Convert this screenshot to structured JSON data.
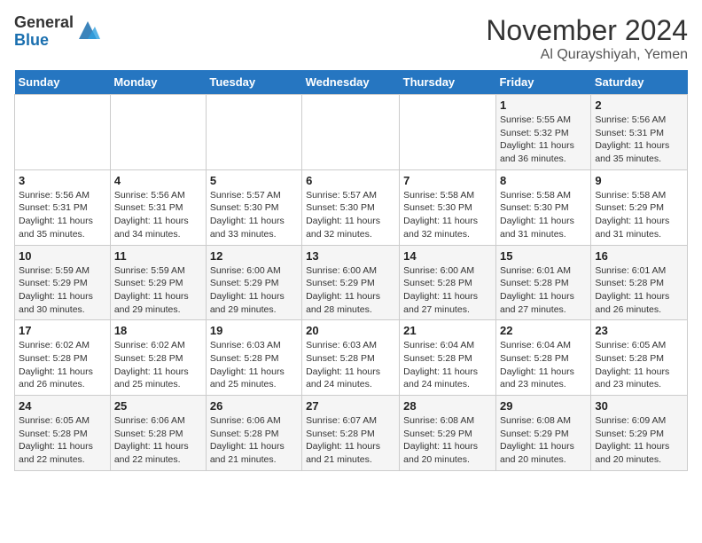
{
  "header": {
    "logo_general": "General",
    "logo_blue": "Blue",
    "month": "November 2024",
    "location": "Al Qurayshiyah, Yemen"
  },
  "weekdays": [
    "Sunday",
    "Monday",
    "Tuesday",
    "Wednesday",
    "Thursday",
    "Friday",
    "Saturday"
  ],
  "weeks": [
    [
      {
        "day": "",
        "info": ""
      },
      {
        "day": "",
        "info": ""
      },
      {
        "day": "",
        "info": ""
      },
      {
        "day": "",
        "info": ""
      },
      {
        "day": "",
        "info": ""
      },
      {
        "day": "1",
        "info": "Sunrise: 5:55 AM\nSunset: 5:32 PM\nDaylight: 11 hours and 36 minutes."
      },
      {
        "day": "2",
        "info": "Sunrise: 5:56 AM\nSunset: 5:31 PM\nDaylight: 11 hours and 35 minutes."
      }
    ],
    [
      {
        "day": "3",
        "info": "Sunrise: 5:56 AM\nSunset: 5:31 PM\nDaylight: 11 hours and 35 minutes."
      },
      {
        "day": "4",
        "info": "Sunrise: 5:56 AM\nSunset: 5:31 PM\nDaylight: 11 hours and 34 minutes."
      },
      {
        "day": "5",
        "info": "Sunrise: 5:57 AM\nSunset: 5:30 PM\nDaylight: 11 hours and 33 minutes."
      },
      {
        "day": "6",
        "info": "Sunrise: 5:57 AM\nSunset: 5:30 PM\nDaylight: 11 hours and 32 minutes."
      },
      {
        "day": "7",
        "info": "Sunrise: 5:58 AM\nSunset: 5:30 PM\nDaylight: 11 hours and 32 minutes."
      },
      {
        "day": "8",
        "info": "Sunrise: 5:58 AM\nSunset: 5:30 PM\nDaylight: 11 hours and 31 minutes."
      },
      {
        "day": "9",
        "info": "Sunrise: 5:58 AM\nSunset: 5:29 PM\nDaylight: 11 hours and 31 minutes."
      }
    ],
    [
      {
        "day": "10",
        "info": "Sunrise: 5:59 AM\nSunset: 5:29 PM\nDaylight: 11 hours and 30 minutes."
      },
      {
        "day": "11",
        "info": "Sunrise: 5:59 AM\nSunset: 5:29 PM\nDaylight: 11 hours and 29 minutes."
      },
      {
        "day": "12",
        "info": "Sunrise: 6:00 AM\nSunset: 5:29 PM\nDaylight: 11 hours and 29 minutes."
      },
      {
        "day": "13",
        "info": "Sunrise: 6:00 AM\nSunset: 5:29 PM\nDaylight: 11 hours and 28 minutes."
      },
      {
        "day": "14",
        "info": "Sunrise: 6:00 AM\nSunset: 5:28 PM\nDaylight: 11 hours and 27 minutes."
      },
      {
        "day": "15",
        "info": "Sunrise: 6:01 AM\nSunset: 5:28 PM\nDaylight: 11 hours and 27 minutes."
      },
      {
        "day": "16",
        "info": "Sunrise: 6:01 AM\nSunset: 5:28 PM\nDaylight: 11 hours and 26 minutes."
      }
    ],
    [
      {
        "day": "17",
        "info": "Sunrise: 6:02 AM\nSunset: 5:28 PM\nDaylight: 11 hours and 26 minutes."
      },
      {
        "day": "18",
        "info": "Sunrise: 6:02 AM\nSunset: 5:28 PM\nDaylight: 11 hours and 25 minutes."
      },
      {
        "day": "19",
        "info": "Sunrise: 6:03 AM\nSunset: 5:28 PM\nDaylight: 11 hours and 25 minutes."
      },
      {
        "day": "20",
        "info": "Sunrise: 6:03 AM\nSunset: 5:28 PM\nDaylight: 11 hours and 24 minutes."
      },
      {
        "day": "21",
        "info": "Sunrise: 6:04 AM\nSunset: 5:28 PM\nDaylight: 11 hours and 24 minutes."
      },
      {
        "day": "22",
        "info": "Sunrise: 6:04 AM\nSunset: 5:28 PM\nDaylight: 11 hours and 23 minutes."
      },
      {
        "day": "23",
        "info": "Sunrise: 6:05 AM\nSunset: 5:28 PM\nDaylight: 11 hours and 23 minutes."
      }
    ],
    [
      {
        "day": "24",
        "info": "Sunrise: 6:05 AM\nSunset: 5:28 PM\nDaylight: 11 hours and 22 minutes."
      },
      {
        "day": "25",
        "info": "Sunrise: 6:06 AM\nSunset: 5:28 PM\nDaylight: 11 hours and 22 minutes."
      },
      {
        "day": "26",
        "info": "Sunrise: 6:06 AM\nSunset: 5:28 PM\nDaylight: 11 hours and 21 minutes."
      },
      {
        "day": "27",
        "info": "Sunrise: 6:07 AM\nSunset: 5:28 PM\nDaylight: 11 hours and 21 minutes."
      },
      {
        "day": "28",
        "info": "Sunrise: 6:08 AM\nSunset: 5:29 PM\nDaylight: 11 hours and 20 minutes."
      },
      {
        "day": "29",
        "info": "Sunrise: 6:08 AM\nSunset: 5:29 PM\nDaylight: 11 hours and 20 minutes."
      },
      {
        "day": "30",
        "info": "Sunrise: 6:09 AM\nSunset: 5:29 PM\nDaylight: 11 hours and 20 minutes."
      }
    ]
  ]
}
